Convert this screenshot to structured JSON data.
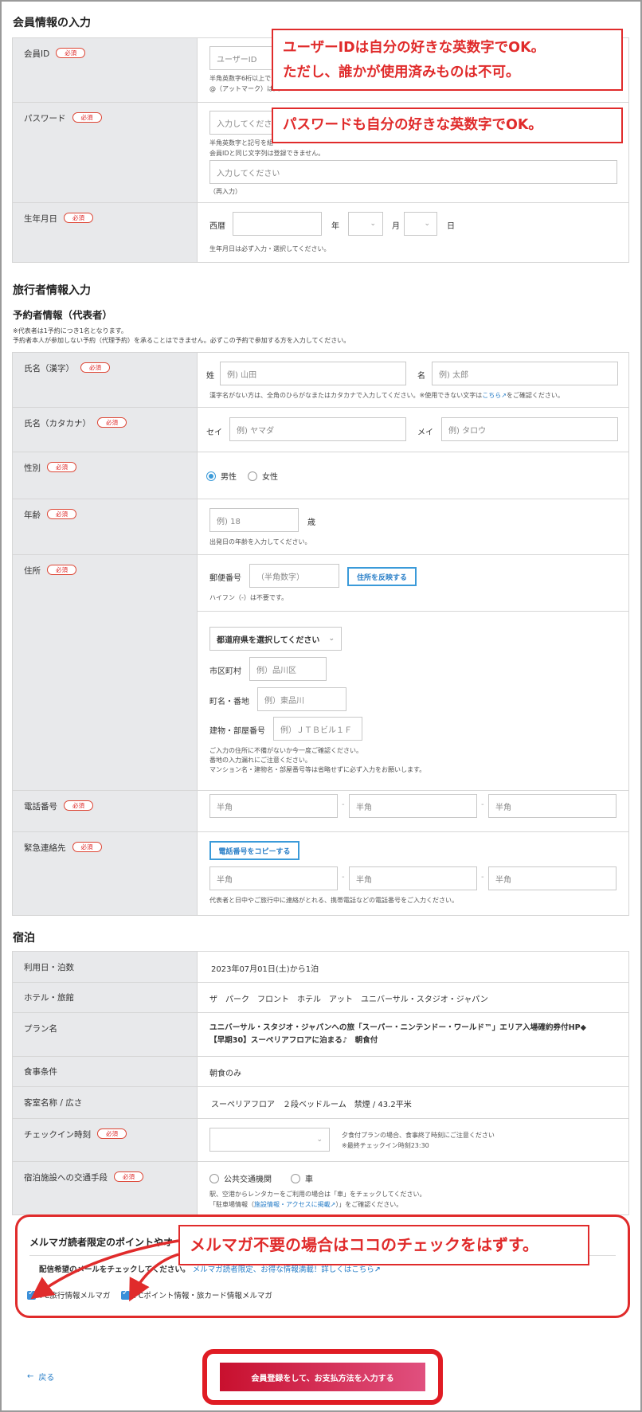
{
  "member": {
    "title": "会員情報の入力",
    "req": "必須",
    "id_label": "会員ID",
    "id_placeholder": "ユーザーID",
    "id_note1": "半角英数字6桁以上で入",
    "id_note2": "@（アットマーク）は入",
    "pw_label": "パスワード",
    "pw_placeholder": "入力してください",
    "pw_note1": "半角英数字と記号を組",
    "pw_note2": "会員IDと同じ文字列は登録できません。",
    "pw2_placeholder": "入力してください",
    "pw2_note": "（再入力）",
    "dob_label": "生年月日",
    "dob_era": "西暦",
    "dob_year": "年",
    "dob_month": "月",
    "dob_day": "日",
    "dob_note": "生年月日は必ず入力・選択してください。"
  },
  "traveler": {
    "title": "旅行者情報入力",
    "sub": "予約者情報（代表者）",
    "note1": "※代表者は1予約につき1名となります。",
    "note2": "予約者本人が参加しない予約（代理予約）を承ることはできません。必ずこの予約で参加する方を入力してください。",
    "name_kanji": "氏名（漢字）",
    "sei": "姓",
    "sei_ph": "例) 山田",
    "mei": "名",
    "mei_ph": "例) 太郎",
    "name_note_a": "漢字名がない方は、全角のひらがなまたはカタカナで入力してください。※使用できない文字は",
    "name_note_link": "こちら",
    "name_note_b": "をご確認ください。",
    "name_kana": "氏名（カタカナ）",
    "sei_k": "セイ",
    "sei_k_ph": "例) ヤマダ",
    "mei_k": "メイ",
    "mei_k_ph": "例) タロウ",
    "gender": "性別",
    "male": "男性",
    "female": "女性",
    "age": "年齢",
    "age_ph": "例) 18",
    "age_unit": "歳",
    "age_note": "出発日の年齢を入力してください。",
    "address": "住所",
    "zip_label": "郵便番号",
    "zip_ph": "（半角数字）",
    "zip_btn": "住所を反映する",
    "zip_note": "ハイフン（-）は不要です。",
    "pref_select": "都道府県を選択してください",
    "city_label": "市区町村",
    "city_ph": "例）品川区",
    "town_label": "町名・番地",
    "town_ph": "例）東品川",
    "bldg_label": "建物・部屋番号",
    "bldg_ph": "例）ＪＴＢビル１Ｆ",
    "addr_note1": "ご入力の住所に不備がないか今一度ご確認ください。",
    "addr_note2": "番地の入力漏れにご注意ください。",
    "addr_note3": "マンション名・建物名・部屋番号等は省略せずに必ず入力をお願いします。",
    "phone": "電話番号",
    "half": "半角",
    "dash": "-",
    "emergency": "緊急連絡先",
    "copy_btn": "電話番号をコピーする",
    "em_note": "代表者と日中やご旅行中に連絡がとれる、携帯電話などの電話番号をご入力ください。"
  },
  "stay": {
    "title": "宿泊",
    "date_label": "利用日・泊数",
    "date_value": "2023年07月01日(土)から1泊",
    "hotel_label": "ホテル・旅館",
    "hotel_value": "ザ　パーク　フロント　ホテル　アット　ユニバーサル・スタジオ・ジャパン",
    "plan_label": "プラン名",
    "plan_value1": "ユニバーサル・スタジオ・ジャパンへの旅「スーパー・ニンテンドー・ワールド™」エリア入場確約券付HP◆",
    "plan_value2": "【早期30】スーペリアフロアに泊まる♪　朝食付",
    "meal_label": "食事条件",
    "meal_value": "朝食のみ",
    "room_label": "客室名称 / 広さ",
    "room_value": "スーペリアフロア　２段ベッドルーム　禁煙 / 43.2平米",
    "checkin_label": "チェックイン時刻",
    "checkin_note1": "夕食付プランの場合、食事終了時刻にご注意ください",
    "checkin_note2": "※最終チェックイン時刻23:30",
    "access_label": "宿泊施設への交通手段",
    "public": "公共交通機関",
    "car": "車",
    "access_note1": "駅、空港からレンタカーをご利用の場合は「車」をチェックしてください。",
    "access_note2a": "「駐車場情報（",
    "access_note2link": "施設情報・アクセスに掲載",
    "access_note2b": "）」をご確認ください。"
  },
  "mailmag": {
    "title": "メルマガ読者限定のポイントやオ",
    "desc": "配信希望のメールをチェックしてください。",
    "desc_link": "メルマガ読者限定、お得な情報満載！詳しくはこちら",
    "opt1": "PC旅行情報メルマガ",
    "opt2": "PCポイント情報・旅カード情報メルマガ"
  },
  "footer": {
    "back": "戻る",
    "submit": "会員登録をして、お支払方法を入力する"
  },
  "callouts": {
    "id_line1": "ユーザーIDは自分の好きな英数字でOK。",
    "id_line2": "ただし、誰かが使用済みものは不可。",
    "pw": "パスワードも自分の好きな英数字でOK。",
    "mail": "メルマガ不要の場合はココのチェックをはずす。"
  },
  "colors": {
    "accent": "#e02b2b",
    "link": "#2a7fc8",
    "button": "#d9305a"
  }
}
